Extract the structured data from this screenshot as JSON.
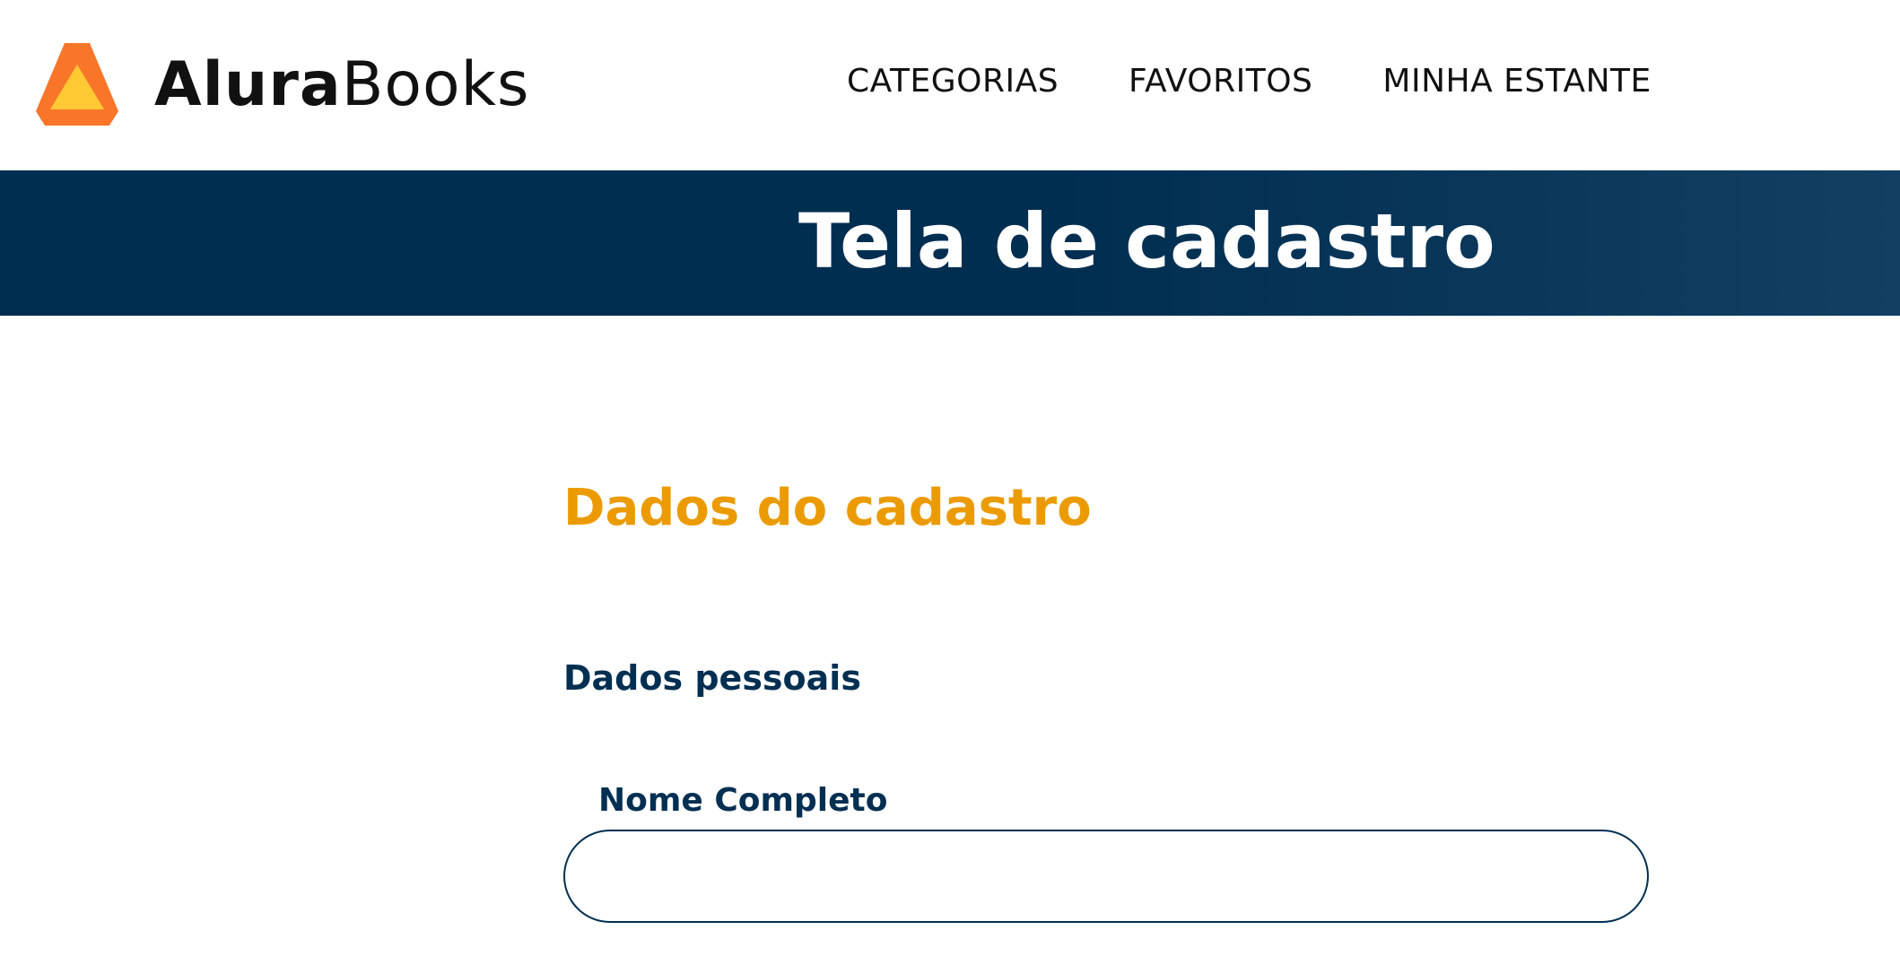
{
  "header": {
    "brand": {
      "part1": "Alura",
      "part2": "Books"
    },
    "nav": [
      {
        "label": "CATEGORIAS"
      },
      {
        "label": "FAVORITOS"
      },
      {
        "label": "MINHA ESTANTE"
      }
    ]
  },
  "banner": {
    "title": "Tela de cadastro"
  },
  "form": {
    "title": "Dados do cadastro",
    "section": "Dados pessoais",
    "fields": [
      {
        "label": "Nome Completo",
        "value": "",
        "placeholder": ""
      }
    ]
  },
  "colors": {
    "banner": "#002e50",
    "accent": "#eb9b00",
    "text_dark": "#002f52",
    "logo_orange": "#f97629",
    "logo_yellow": "#ffc933"
  }
}
